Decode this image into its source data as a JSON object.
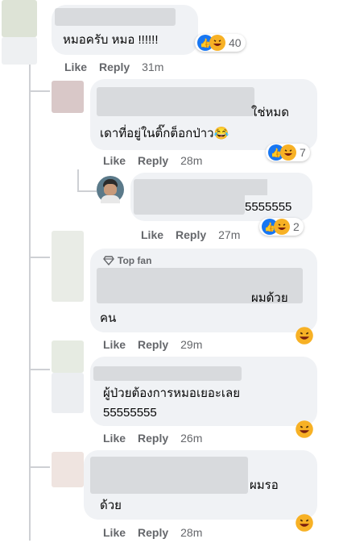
{
  "comments": [
    {
      "text_lines": [
        "หมอครับ หมอ !!!!!!"
      ],
      "like": "Like",
      "reply": "Reply",
      "time": "31m",
      "reaction_count": "40"
    },
    {
      "text_lines": [
        "ใช่หมด",
        "เดาที่อยู่ในติ๊กต็อกป่าว😂"
      ],
      "like": "Like",
      "reply": "Reply",
      "time": "28m",
      "reaction_count": "7"
    },
    {
      "text_lines": [
        "5555555"
      ],
      "like": "Like",
      "reply": "Reply",
      "time": "27m",
      "reaction_count": "2"
    },
    {
      "badge": "Top fan",
      "text_lines": [
        "ผมด้วย",
        "คน"
      ],
      "like": "Like",
      "reply": "Reply",
      "time": "29m"
    },
    {
      "text_lines": [
        "ผู้ป่วยต้องการหมอเยอะเลย",
        "55555555"
      ],
      "like": "Like",
      "reply": "Reply",
      "time": "26m"
    },
    {
      "text_lines": [
        "ผมรอ",
        "ด้วย"
      ],
      "like": "Like",
      "reply": "Reply",
      "time": "28m"
    }
  ],
  "icons": {
    "like": "like-reaction-icon",
    "haha": "haha-reaction-icon",
    "badge": "diamond-icon"
  },
  "colors": {
    "bubble": "#f0f2f5",
    "meta": "#65676b",
    "like_blue": "#1877f2",
    "haha_yellow": "#f7b125"
  }
}
